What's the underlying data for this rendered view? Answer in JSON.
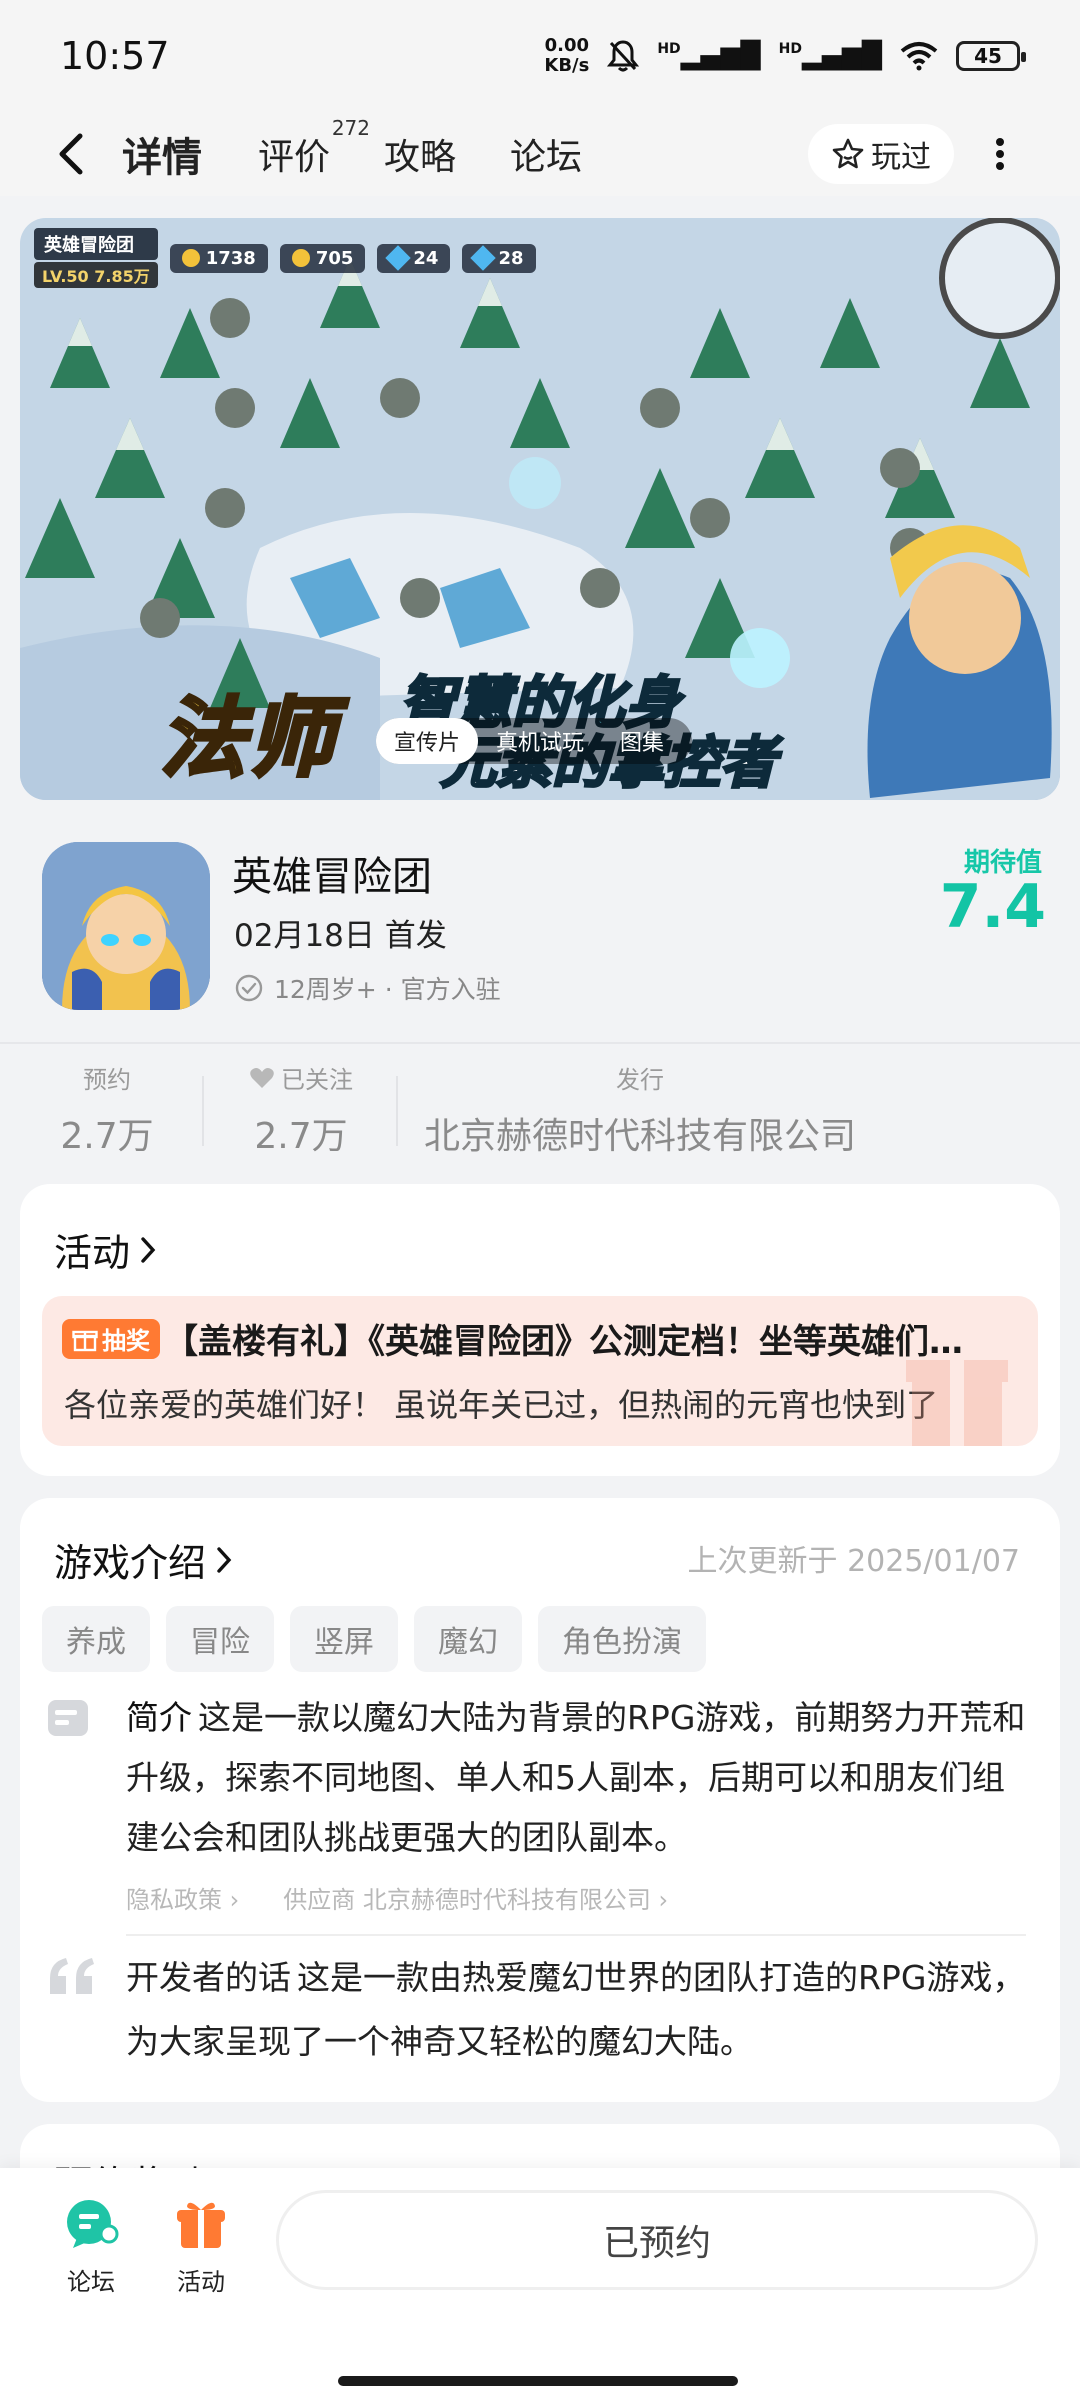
{
  "status_bar": {
    "time": "10:57",
    "net_speed_value": "0.00",
    "net_speed_unit": "KB/s",
    "signal_1": "HD",
    "signal_2": "HD",
    "battery": "45"
  },
  "nav": {
    "tabs": [
      {
        "label": "详情",
        "active": true
      },
      {
        "label": "评价",
        "count": "272"
      },
      {
        "label": "攻略"
      },
      {
        "label": "论坛"
      }
    ],
    "played_label": "玩过"
  },
  "banner": {
    "hud_name": "英雄冒险团",
    "hud_level": "LV.50",
    "hud_power": "7.85万",
    "hud_gold": "1738",
    "hud_coin": "705",
    "hud_gem": "24",
    "hud_other": "28",
    "title_1": "法师",
    "title_2": "智慧的化身",
    "title_3": "元素的掌控者",
    "media_tabs": [
      "宣传片",
      "真机试玩",
      "图集"
    ],
    "media_active": "宣传片"
  },
  "game": {
    "name": "英雄冒险团",
    "release": "02月18日 首发",
    "meta": "12周岁+ · 官方入驻",
    "expect_label": "期待值",
    "expect_value": "7.4"
  },
  "stats": {
    "reserve_label": "预约",
    "reserve_value": "2.7万",
    "follow_label": "已关注",
    "follow_value": "2.7万",
    "publisher_label": "发行",
    "publisher_value": "北京赫德时代科技有限公司"
  },
  "activity": {
    "title": "活动",
    "badge": "抽奖",
    "headline": "【盖楼有礼】《英雄冒险团》公测定档！坐等英雄们回归",
    "summary": "各位亲爱的英雄们好！ 虽说年关已过，但热闹的元宵也快到了"
  },
  "intro": {
    "title": "游戏介绍",
    "updated": "上次更新于 2025/01/07",
    "tags": [
      "养成",
      "冒险",
      "竖屏",
      "魔幻",
      "角色扮演"
    ],
    "summary_label": "简介",
    "summary": "这是一款以魔幻大陆为背景的RPG游戏，前期努力开荒和升级，探索不同地图、单人和5人副本，后期可以和朋友们组建公会和团队挑战更强大的团队副本。",
    "privacy": "隐私政策",
    "supplier": "供应商 北京赫德时代科技有限公司",
    "dev_label": "开发者的话",
    "dev_words": "这是一款由热爱魔幻世界的团队打造的RPG游戏，为大家呈现了一个神奇又轻松的魔幻大陆。"
  },
  "next_section_title": "预约奖励",
  "bottom_bar": {
    "forum": "论坛",
    "activity": "活动",
    "reserved": "已预约"
  },
  "colors": {
    "accent": "#13c4a5",
    "activity_bg": "#fde9e4",
    "lottery": "#ff7a33"
  },
  "icons": [
    "back-arrow-icon",
    "star-outline-icon",
    "more-vertical-icon",
    "check-circle-icon",
    "heart-icon",
    "gift-icon",
    "document-icon",
    "quote-icon",
    "chat-bubble-icon"
  ]
}
